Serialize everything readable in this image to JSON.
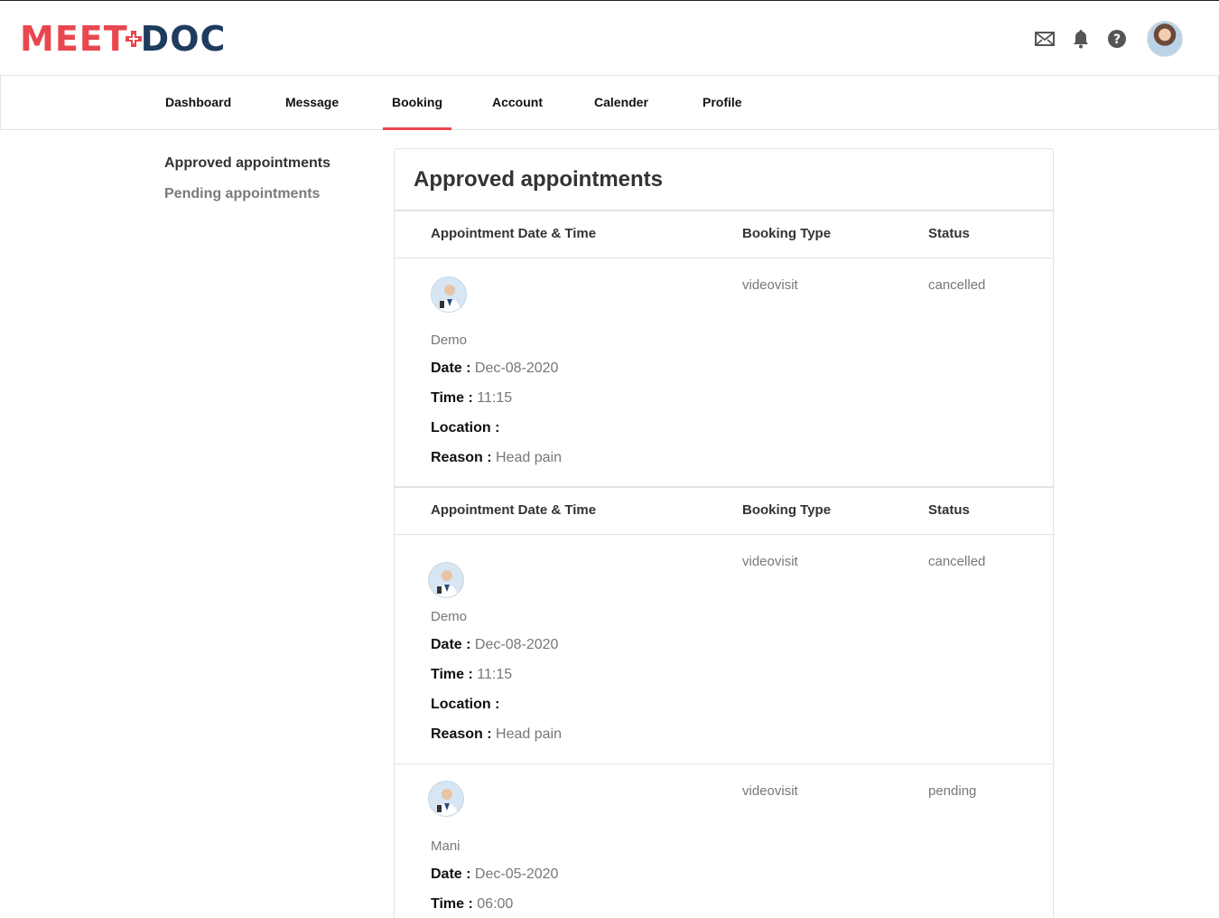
{
  "brand": {
    "meet": "MEET",
    "doc": "DOC"
  },
  "header": {
    "icons": [
      "mail-icon",
      "bell-icon",
      "help-icon"
    ]
  },
  "nav": {
    "items": [
      "Dashboard",
      "Message",
      "Booking",
      "Account",
      "Calender",
      "Profile"
    ],
    "active": "Booking"
  },
  "sidebar": {
    "approved": "Approved appointments",
    "pending": "Pending appointments"
  },
  "card": {
    "title": "Approved appointments",
    "columns": {
      "datetime": "Appointment Date & Time",
      "type": "Booking Type",
      "status": "Status"
    }
  },
  "labels": {
    "date": "Date :",
    "time": "Time :",
    "location": "Location :",
    "reason": "Reason :"
  },
  "appointments": [
    {
      "name": "Demo",
      "date": "Dec-08-2020",
      "time": "11:15",
      "location": "",
      "reason": "Head pain",
      "type": "videovisit",
      "status": "cancelled"
    },
    {
      "name": "Demo",
      "date": "Dec-08-2020",
      "time": "11:15",
      "location": "",
      "reason": "Head pain",
      "type": "videovisit",
      "status": "cancelled"
    },
    {
      "name": "Mani",
      "date": "Dec-05-2020",
      "time": "06:00",
      "type": "videovisit",
      "status": "pending"
    }
  ],
  "colors": {
    "accent": "#e8474f",
    "navy": "#1d3c5f"
  }
}
